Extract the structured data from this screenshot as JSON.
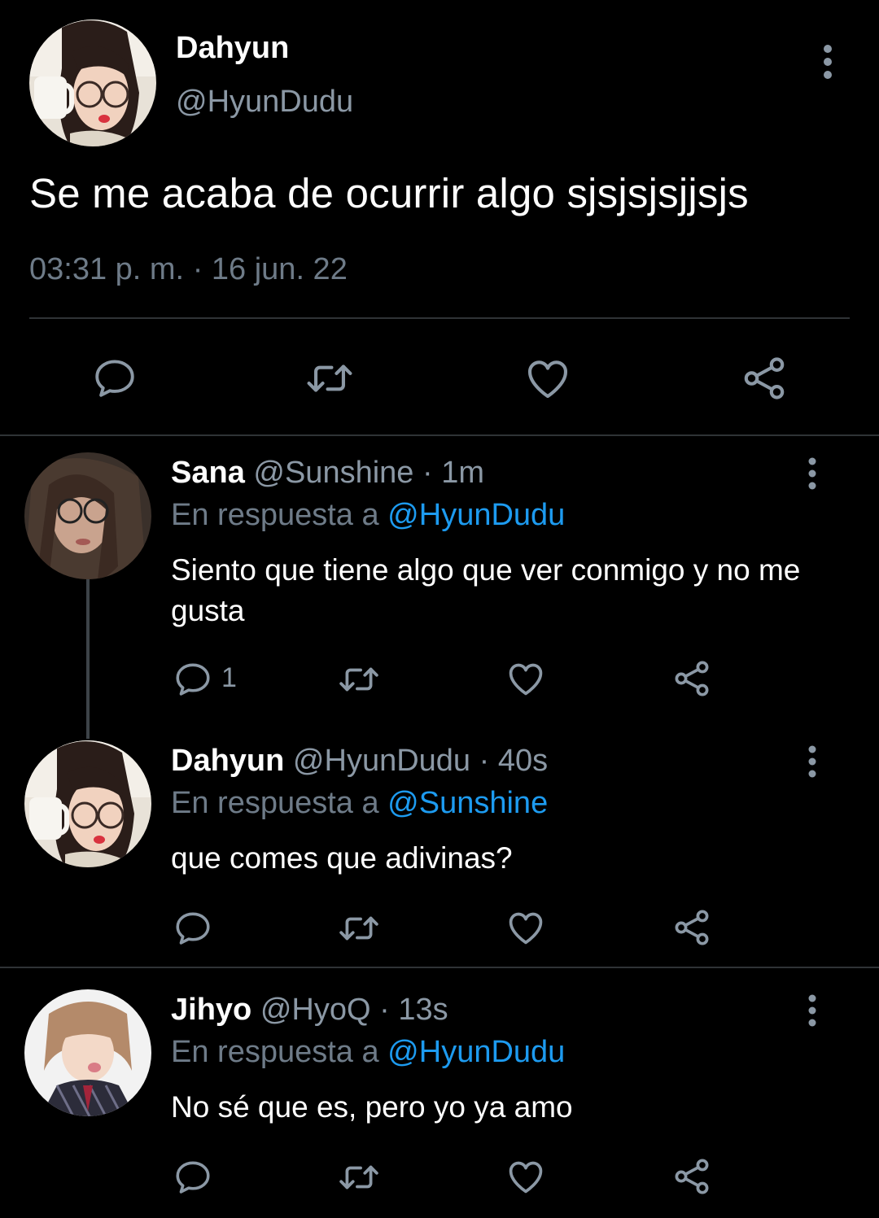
{
  "main_tweet": {
    "author_name": "Dahyun",
    "author_handle": "@HyunDudu",
    "text": "Se me acaba de ocurrir algo sjsjsjsjjsjs",
    "time": "03:31 p. m.",
    "separator": "·",
    "date": "16 jun. 22",
    "actions": [
      "reply-icon",
      "retweet-icon",
      "like-icon",
      "share-icon"
    ]
  },
  "replies": [
    {
      "author_name": "Sana",
      "author_handle": "@Sunshine",
      "separator": "·",
      "time": "1m",
      "reply_prefix": "En respuesta a",
      "reply_to": "@HyunDudu",
      "text": "Siento que tiene algo que ver conmigo y no me gusta",
      "reply_count": "1"
    },
    {
      "author_name": "Dahyun",
      "author_handle": "@HyunDudu",
      "separator": "·",
      "time": "40s",
      "reply_prefix": "En respuesta a",
      "reply_to": "@Sunshine",
      "text": "que comes que adivinas?",
      "reply_count": ""
    },
    {
      "author_name": "Jihyo",
      "author_handle": "@HyoQ",
      "separator": "·",
      "time": "13s",
      "reply_prefix": "En respuesta a",
      "reply_to": "@HyunDudu",
      "text": "No sé que es, pero yo ya amo",
      "reply_count": ""
    }
  ],
  "colors": {
    "background": "#000000",
    "text": "#ffffff",
    "secondary": "#8b98a5",
    "link": "#1d9bf0",
    "icon": "#8b98a5",
    "divider": "#2f3336"
  }
}
